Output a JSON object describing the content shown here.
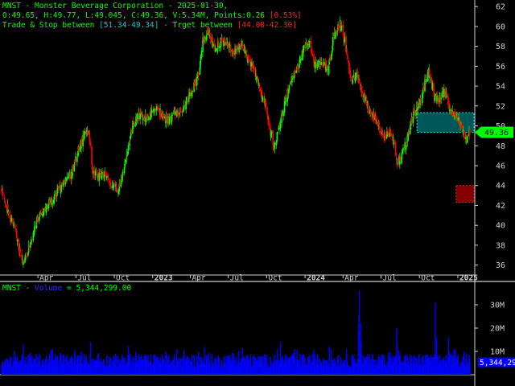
{
  "header": {
    "line1": "MNST - Monster Beverage Corporation - 2025-01-30,",
    "line2_main": "O:49.65, H:49.77, L:49.045, C:49.36, V:5.34M, Points:0.26 ",
    "line2_pct": "[0.53%]",
    "line3_a": "Trade & Stop between ",
    "line3_zone": "[51.34-49.34]",
    "line3_b": " - Trget between ",
    "line3_target": "[44.00-42.30]"
  },
  "volume_header": {
    "ticker": "MNST - ",
    "name": "Volume",
    "value_text": " = 5,344,299.00"
  },
  "colors": {
    "background": "#000000",
    "up": "#00ff00",
    "down": "#ff0000",
    "text": "#00ff00",
    "axis": "#cfcfcf",
    "volume": "#0000ff",
    "trade_zone": "#00c0c0",
    "target_zone": "#cc0000"
  },
  "chart_data": [
    {
      "type": "candlestick",
      "ticker": "MNST",
      "title": "MNST - Monster Beverage Corporation - 2025-01-30,",
      "y_ticks": [
        36,
        38,
        40,
        42,
        44,
        46,
        48,
        50,
        52,
        54,
        56,
        58,
        60,
        62
      ],
      "ylim": [
        35,
        62.5
      ],
      "x_ticks": [
        "Apr",
        "Jul",
        "Oct",
        "2023",
        "Apr",
        "Jul",
        "Oct",
        "2024",
        "Apr",
        "Jul",
        "Oct",
        "2025"
      ],
      "x_tick_dates": [
        "2022-04-01",
        "2022-07-01",
        "2022-10-01",
        "2023-01-01",
        "2023-04-01",
        "2023-07-01",
        "2023-10-01",
        "2024-01-01",
        "2024-04-01",
        "2024-07-01",
        "2024-10-01",
        "2025-01-01"
      ],
      "x_range": [
        "2022-01-04",
        "2025-01-30"
      ],
      "last_price": 49.36,
      "last_price_label": "49.36",
      "last_bar": {
        "date": "2025-01-30",
        "open": 49.65,
        "high": 49.77,
        "low": 49.045,
        "close": 49.36
      },
      "trade_stop_zone": [
        49.34,
        51.34
      ],
      "target_zone": [
        42.3,
        44.0
      ],
      "zone_dates": [
        "2024-09-25",
        "2025-01-30"
      ],
      "close_path": [
        [
          "2022-01-04",
          43.5
        ],
        [
          "2022-01-20",
          41.5
        ],
        [
          "2022-02-05",
          39.5
        ],
        [
          "2022-02-18",
          37.0
        ],
        [
          "2022-03-01",
          36.3
        ],
        [
          "2022-03-15",
          38.5
        ],
        [
          "2022-04-01",
          40.5
        ],
        [
          "2022-04-20",
          41.8
        ],
        [
          "2022-05-05",
          42.5
        ],
        [
          "2022-05-20",
          43.5
        ],
        [
          "2022-06-05",
          44.2
        ],
        [
          "2022-06-20",
          45.2
        ],
        [
          "2022-07-05",
          47.3
        ],
        [
          "2022-07-20",
          49.0
        ],
        [
          "2022-08-01",
          49.4
        ],
        [
          "2022-08-10",
          45.5
        ],
        [
          "2022-08-25",
          44.8
        ],
        [
          "2022-09-10",
          45.2
        ],
        [
          "2022-09-25",
          44.0
        ],
        [
          "2022-10-10",
          43.6
        ],
        [
          "2022-10-25",
          45.5
        ],
        [
          "2022-11-05",
          48.5
        ],
        [
          "2022-11-15",
          50.3
        ],
        [
          "2022-12-01",
          51.0
        ],
        [
          "2022-12-20",
          50.8
        ],
        [
          "2023-01-10",
          51.8
        ],
        [
          "2023-01-25",
          51.0
        ],
        [
          "2023-02-10",
          50.5
        ],
        [
          "2023-02-25",
          51.5
        ],
        [
          "2023-03-10",
          51.0
        ],
        [
          "2023-03-25",
          52.5
        ],
        [
          "2023-04-05",
          53.5
        ],
        [
          "2023-04-20",
          55.0
        ],
        [
          "2023-05-01",
          58.5
        ],
        [
          "2023-05-15",
          59.5
        ],
        [
          "2023-05-30",
          57.8
        ],
        [
          "2023-06-15",
          58.5
        ],
        [
          "2023-07-01",
          58.0
        ],
        [
          "2023-07-15",
          57.2
        ],
        [
          "2023-08-01",
          58.3
        ],
        [
          "2023-08-15",
          57.0
        ],
        [
          "2023-09-01",
          55.8
        ],
        [
          "2023-09-15",
          53.5
        ],
        [
          "2023-10-01",
          51.5
        ],
        [
          "2023-10-10",
          49.5
        ],
        [
          "2023-10-20",
          48.0
        ],
        [
          "2023-11-01",
          50.0
        ],
        [
          "2023-11-15",
          52.5
        ],
        [
          "2023-12-01",
          55.0
        ],
        [
          "2023-12-15",
          56.0
        ],
        [
          "2024-01-01",
          58.0
        ],
        [
          "2024-01-10",
          58.5
        ],
        [
          "2024-01-25",
          56.0
        ],
        [
          "2024-02-10",
          56.5
        ],
        [
          "2024-02-25",
          55.5
        ],
        [
          "2024-03-10",
          59.0
        ],
        [
          "2024-03-25",
          60.3
        ],
        [
          "2024-04-05",
          58.5
        ],
        [
          "2024-04-20",
          54.5
        ],
        [
          "2024-05-05",
          55.0
        ],
        [
          "2024-05-20",
          53.0
        ],
        [
          "2024-06-05",
          51.5
        ],
        [
          "2024-06-20",
          50.5
        ],
        [
          "2024-07-05",
          49.0
        ],
        [
          "2024-07-20",
          49.5
        ],
        [
          "2024-08-01",
          48.5
        ],
        [
          "2024-08-10",
          46.0
        ],
        [
          "2024-08-20",
          47.0
        ],
        [
          "2024-09-01",
          48.5
        ],
        [
          "2024-09-15",
          51.0
        ],
        [
          "2024-09-25",
          52.0
        ],
        [
          "2024-10-05",
          52.5
        ],
        [
          "2024-10-15",
          54.5
        ],
        [
          "2024-10-25",
          55.5
        ],
        [
          "2024-11-05",
          53.0
        ],
        [
          "2024-11-15",
          52.5
        ],
        [
          "2024-12-01",
          53.5
        ],
        [
          "2024-12-15",
          51.5
        ],
        [
          "2024-12-28",
          51.0
        ],
        [
          "2025-01-10",
          50.0
        ],
        [
          "2025-01-20",
          48.5
        ],
        [
          "2025-01-30",
          49.36
        ]
      ]
    },
    {
      "type": "bar",
      "title": "MNST - Volume = 5,344,299.00",
      "series_name": "Volume",
      "last_volume": 5344299.0,
      "last_volume_label": "5,344,29",
      "y_ticks": [
        10000000,
        20000000,
        30000000
      ],
      "y_tick_labels": [
        "10M",
        "20M",
        "30M"
      ],
      "ylim": [
        0,
        40000000
      ],
      "typical_volume_range": [
        3000000,
        9000000
      ],
      "spikes": [
        [
          "2022-02-25",
          13000000
        ],
        [
          "2022-05-06",
          11000000
        ],
        [
          "2022-08-05",
          14000000
        ],
        [
          "2022-11-04",
          12500000
        ],
        [
          "2023-02-28",
          11000000
        ],
        [
          "2023-05-05",
          12000000
        ],
        [
          "2023-08-04",
          11500000
        ],
        [
          "2023-11-03",
          14000000
        ],
        [
          "2024-02-28",
          12000000
        ],
        [
          "2024-05-08",
          18000000
        ],
        [
          "2024-05-09",
          26000000
        ],
        [
          "2024-05-10",
          36000000
        ],
        [
          "2024-05-13",
          22000000
        ],
        [
          "2024-05-14",
          14000000
        ],
        [
          "2024-08-08",
          20000000
        ],
        [
          "2024-08-09",
          13000000
        ],
        [
          "2024-11-08",
          31000000
        ],
        [
          "2024-11-11",
          16000000
        ],
        [
          "2024-12-10",
          16000000
        ],
        [
          "2025-01-16",
          10000000
        ]
      ]
    }
  ]
}
